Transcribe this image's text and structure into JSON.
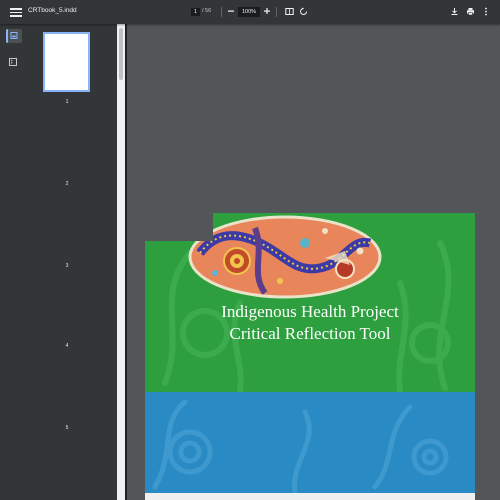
{
  "toolbar": {
    "file_name": "CRTbook_5.indd",
    "current_page": "1",
    "page_total": "/ 56",
    "zoom": "100%"
  },
  "sidebar": {
    "page_numbers": [
      "1",
      "2",
      "3",
      "4",
      "5"
    ]
  },
  "document": {
    "title_line1": "Indigenous Health Project",
    "title_line2": "Critical Reflection Tool"
  },
  "colors": {
    "toolbar_bg": "#323639",
    "viewer_bg": "#525659",
    "cover_green": "#2d9f3f",
    "cover_blue": "#2a8bc4",
    "accent": "#8ab4f8"
  }
}
